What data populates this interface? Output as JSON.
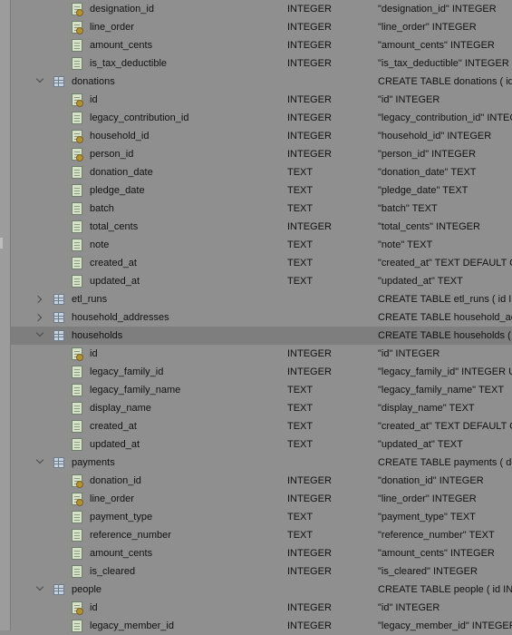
{
  "rows": [
    {
      "kind": "col",
      "key": true,
      "name": "designation_id",
      "type": "INTEGER",
      "def": "\"designation_id\" INTEGER"
    },
    {
      "kind": "col",
      "key": true,
      "name": "line_order",
      "type": "INTEGER",
      "def": "\"line_order\" INTEGER"
    },
    {
      "kind": "col",
      "key": false,
      "name": "amount_cents",
      "type": "INTEGER",
      "def": "\"amount_cents\" INTEGER"
    },
    {
      "kind": "col",
      "key": false,
      "name": "is_tax_deductible",
      "type": "INTEGER",
      "def": "\"is_tax_deductible\" INTEGER"
    },
    {
      "kind": "table",
      "open": true,
      "name": "donations",
      "type": "",
      "def": "CREATE TABLE donations ( id I"
    },
    {
      "kind": "col",
      "key": true,
      "name": "id",
      "type": "INTEGER",
      "def": "\"id\" INTEGER"
    },
    {
      "kind": "col",
      "key": false,
      "name": "legacy_contribution_id",
      "type": "INTEGER",
      "def": "\"legacy_contribution_id\" INTEG"
    },
    {
      "kind": "col",
      "key": true,
      "name": "household_id",
      "type": "INTEGER",
      "def": "\"household_id\" INTEGER"
    },
    {
      "kind": "col",
      "key": true,
      "name": "person_id",
      "type": "INTEGER",
      "def": "\"person_id\" INTEGER"
    },
    {
      "kind": "col",
      "key": false,
      "name": "donation_date",
      "type": "TEXT",
      "def": "\"donation_date\" TEXT"
    },
    {
      "kind": "col",
      "key": false,
      "name": "pledge_date",
      "type": "TEXT",
      "def": "\"pledge_date\" TEXT"
    },
    {
      "kind": "col",
      "key": false,
      "name": "batch",
      "type": "TEXT",
      "def": "\"batch\" TEXT"
    },
    {
      "kind": "col",
      "key": false,
      "name": "total_cents",
      "type": "INTEGER",
      "def": "\"total_cents\" INTEGER"
    },
    {
      "kind": "col",
      "key": false,
      "name": "note",
      "type": "TEXT",
      "def": "\"note\" TEXT"
    },
    {
      "kind": "col",
      "key": false,
      "name": "created_at",
      "type": "TEXT",
      "def": "\"created_at\" TEXT DEFAULT C"
    },
    {
      "kind": "col",
      "key": false,
      "name": "updated_at",
      "type": "TEXT",
      "def": "\"updated_at\" TEXT"
    },
    {
      "kind": "table",
      "open": false,
      "name": "etl_runs",
      "type": "",
      "def": "CREATE TABLE etl_runs ( id IN"
    },
    {
      "kind": "table",
      "open": false,
      "name": "household_addresses",
      "type": "",
      "def": "CREATE TABLE household_add"
    },
    {
      "kind": "table",
      "open": true,
      "selected": true,
      "name": "households",
      "type": "",
      "def": "CREATE TABLE households ( id"
    },
    {
      "kind": "col",
      "key": true,
      "name": "id",
      "type": "INTEGER",
      "def": "\"id\" INTEGER"
    },
    {
      "kind": "col",
      "key": false,
      "name": "legacy_family_id",
      "type": "INTEGER",
      "def": "\"legacy_family_id\" INTEGER UN"
    },
    {
      "kind": "col",
      "key": false,
      "name": "legacy_family_name",
      "type": "TEXT",
      "def": "\"legacy_family_name\" TEXT"
    },
    {
      "kind": "col",
      "key": false,
      "name": "display_name",
      "type": "TEXT",
      "def": "\"display_name\" TEXT"
    },
    {
      "kind": "col",
      "key": false,
      "name": "created_at",
      "type": "TEXT",
      "def": "\"created_at\" TEXT DEFAULT C"
    },
    {
      "kind": "col",
      "key": false,
      "name": "updated_at",
      "type": "TEXT",
      "def": "\"updated_at\" TEXT"
    },
    {
      "kind": "table",
      "open": true,
      "name": "payments",
      "type": "",
      "def": "CREATE TABLE payments ( don"
    },
    {
      "kind": "col",
      "key": true,
      "name": "donation_id",
      "type": "INTEGER",
      "def": "\"donation_id\" INTEGER"
    },
    {
      "kind": "col",
      "key": true,
      "name": "line_order",
      "type": "INTEGER",
      "def": "\"line_order\" INTEGER"
    },
    {
      "kind": "col",
      "key": false,
      "name": "payment_type",
      "type": "TEXT",
      "def": "\"payment_type\" TEXT"
    },
    {
      "kind": "col",
      "key": false,
      "name": "reference_number",
      "type": "TEXT",
      "def": "\"reference_number\" TEXT"
    },
    {
      "kind": "col",
      "key": false,
      "name": "amount_cents",
      "type": "INTEGER",
      "def": "\"amount_cents\" INTEGER"
    },
    {
      "kind": "col",
      "key": false,
      "name": "is_cleared",
      "type": "INTEGER",
      "def": "\"is_cleared\" INTEGER"
    },
    {
      "kind": "table",
      "open": true,
      "name": "people",
      "type": "",
      "def": "CREATE TABLE people ( id INTE"
    },
    {
      "kind": "col",
      "key": true,
      "name": "id",
      "type": "INTEGER",
      "def": "\"id\" INTEGER"
    },
    {
      "kind": "col",
      "key": false,
      "name": "legacy_member_id",
      "type": "INTEGER",
      "def": "\"legacy_member_id\" INTEGER"
    }
  ]
}
